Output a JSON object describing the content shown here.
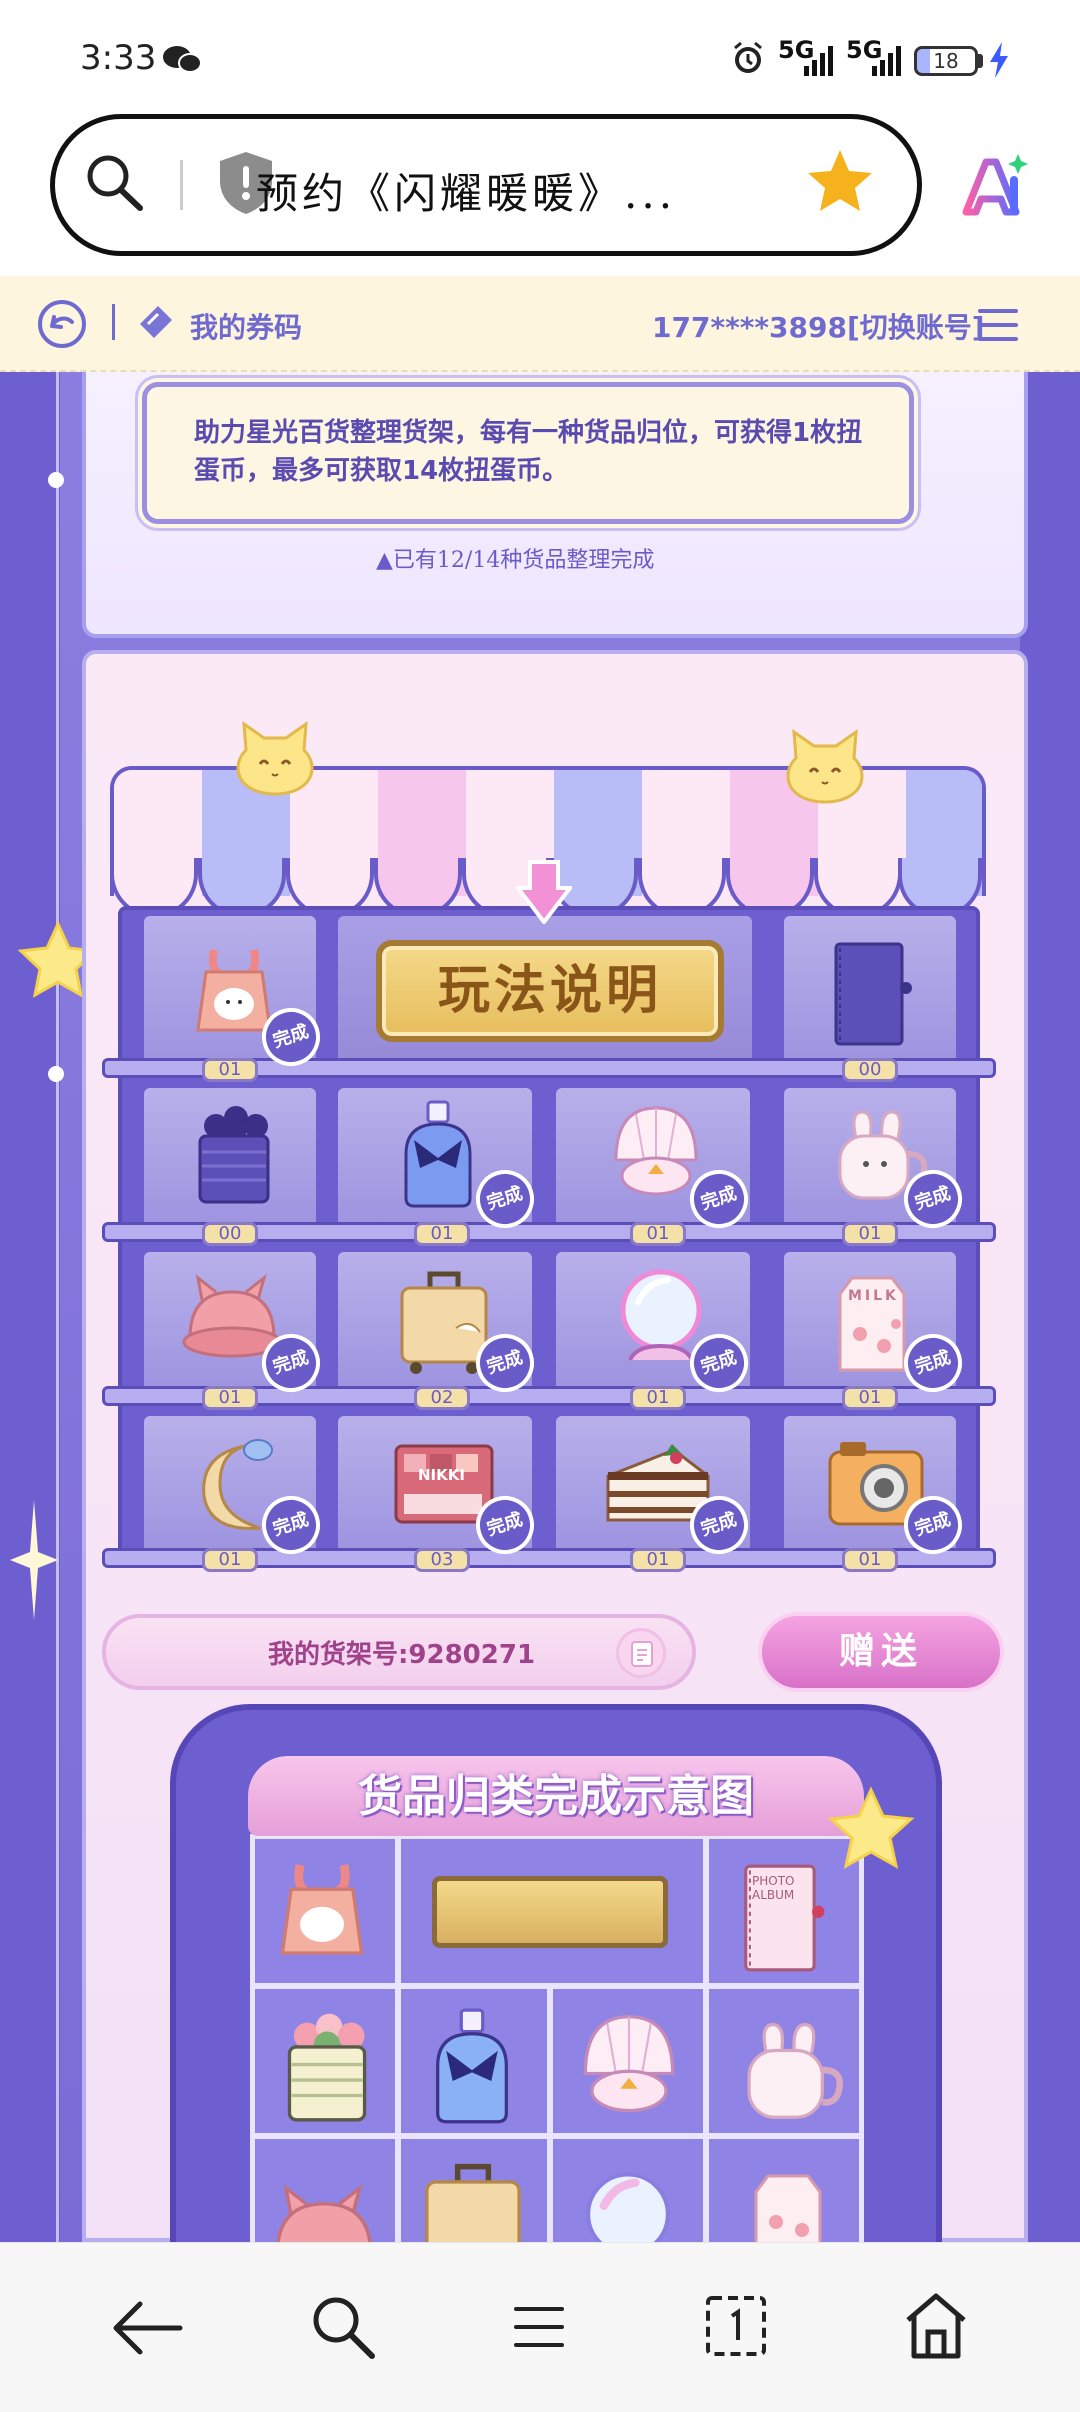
{
  "status_bar": {
    "time": "3:33",
    "network_1": "5G",
    "network_2": "5G",
    "battery": "18"
  },
  "browser": {
    "page_title": "预约《闪耀暖暖》..."
  },
  "sub_header": {
    "coupon_label": "我的券码",
    "account": "177****3898[切换账号]"
  },
  "info": {
    "description": "助力星光百货整理货架，每有一种货品归位，可获得1枚扭蛋币，最多可获取14枚扭蛋币。",
    "progress": "▲已有12/14种货品整理完成"
  },
  "shelf": {
    "rules_button": "玩法说明",
    "done_label": "完成",
    "row1_tags": [
      "01",
      "00"
    ],
    "row2_tags": [
      "00",
      "01",
      "01",
      "01"
    ],
    "row3_tags": [
      "01",
      "02",
      "01",
      "01"
    ],
    "row4_tags": [
      "01",
      "03",
      "01",
      "01"
    ],
    "nikki_label": "NIKKI",
    "milk_label": "MILK",
    "album_label": "PHOTO ALBUM"
  },
  "shelf_id": "我的货架号:9280271",
  "gift_button": "赠送",
  "diagram": {
    "title": "货品归类完成示意图"
  },
  "colors": {
    "primary_purple": "#6d5fd0",
    "pink": "#e69fd8",
    "gold": "#e7bd5c"
  }
}
